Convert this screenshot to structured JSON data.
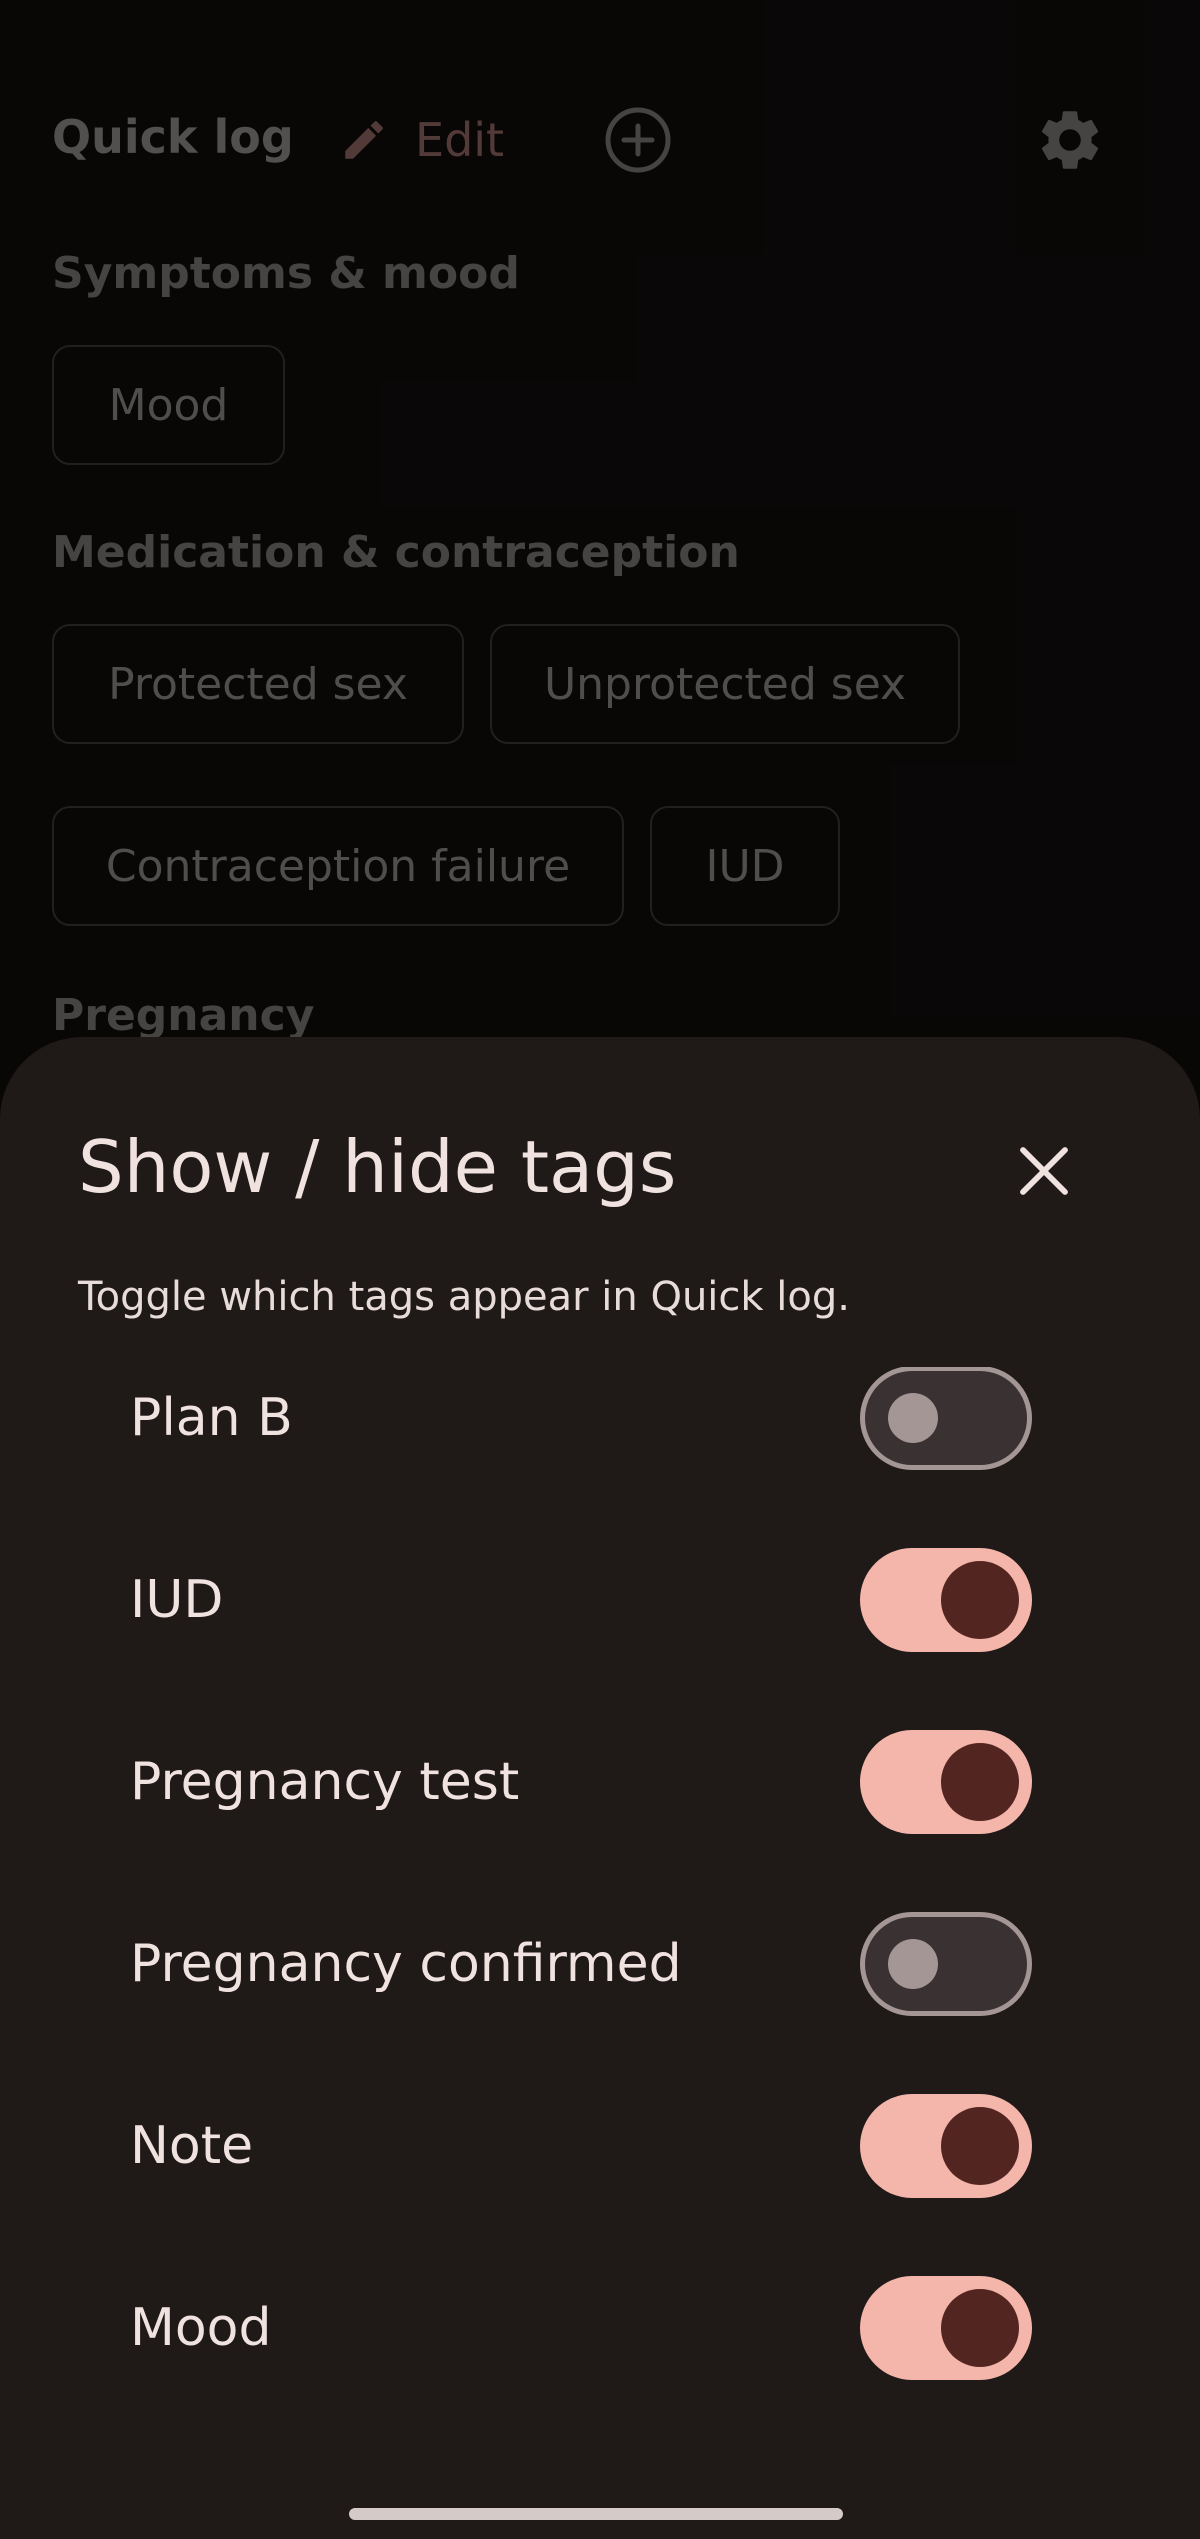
{
  "quick_log": {
    "title": "Quick log",
    "edit_label": "Edit",
    "edit_icon": "pencil-icon",
    "add_icon": "add-circle-icon",
    "settings_icon": "gear-icon",
    "sections": [
      {
        "title": "Symptoms & mood",
        "chips": [
          "Mood"
        ]
      },
      {
        "title": "Medication & contraception",
        "chips": [
          "Protected sex",
          "Unprotected sex",
          "Contraception failure",
          "IUD"
        ]
      },
      {
        "title": "Pregnancy",
        "chips": []
      }
    ]
  },
  "sheet": {
    "title": "Show / hide tags",
    "subtitle": "Toggle which tags appear in Quick log.",
    "close_icon": "close-icon",
    "items": [
      {
        "label": "Plan B",
        "enabled": false
      },
      {
        "label": "IUD",
        "enabled": true
      },
      {
        "label": "Pregnancy test",
        "enabled": true
      },
      {
        "label": "Pregnancy confirmed",
        "enabled": false
      },
      {
        "label": "Note",
        "enabled": true
      },
      {
        "label": "Mood",
        "enabled": true
      }
    ]
  },
  "colors": {
    "accent": "#f4b6ab",
    "accent_dark": "#532520",
    "sheet_bg": "#1f1918",
    "edit_tint": "#6e4e4c"
  }
}
